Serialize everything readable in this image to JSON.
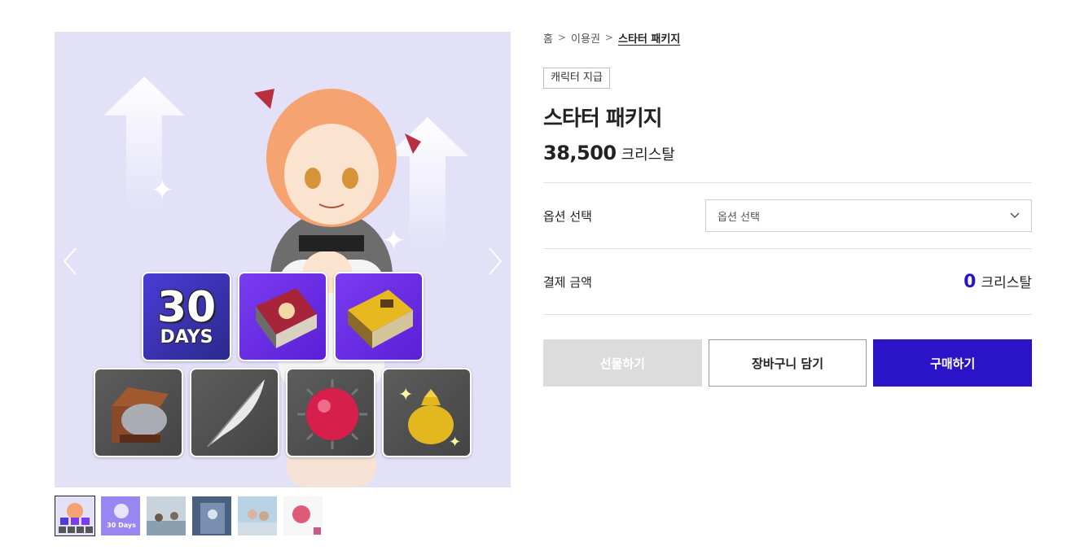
{
  "breadcrumb": {
    "items": [
      "홈",
      "이용권",
      "스타터 패키지"
    ]
  },
  "product": {
    "badge": "캐릭터 지급",
    "title": "스타터 패키지",
    "price": "38,500",
    "price_unit": "크리스탈"
  },
  "gallery": {
    "tile_days_number": "30",
    "tile_days_label": "DAYS",
    "thumb_days_number": "30 Days",
    "active_thumb": 1,
    "thumb_count": 6
  },
  "options": {
    "label": "옵션 선택",
    "select_value": "옵션 선택"
  },
  "total": {
    "label": "결제 금액",
    "amount": "0",
    "unit": "크리스탈"
  },
  "actions": {
    "gift_label": "선물하기",
    "cart_label": "장바구니 담기",
    "buy_label": "구매하기"
  },
  "colors": {
    "accent": "#2b14c8",
    "gift_disabled": "#dcdcdc",
    "image_bg": "#e3e1f8"
  }
}
